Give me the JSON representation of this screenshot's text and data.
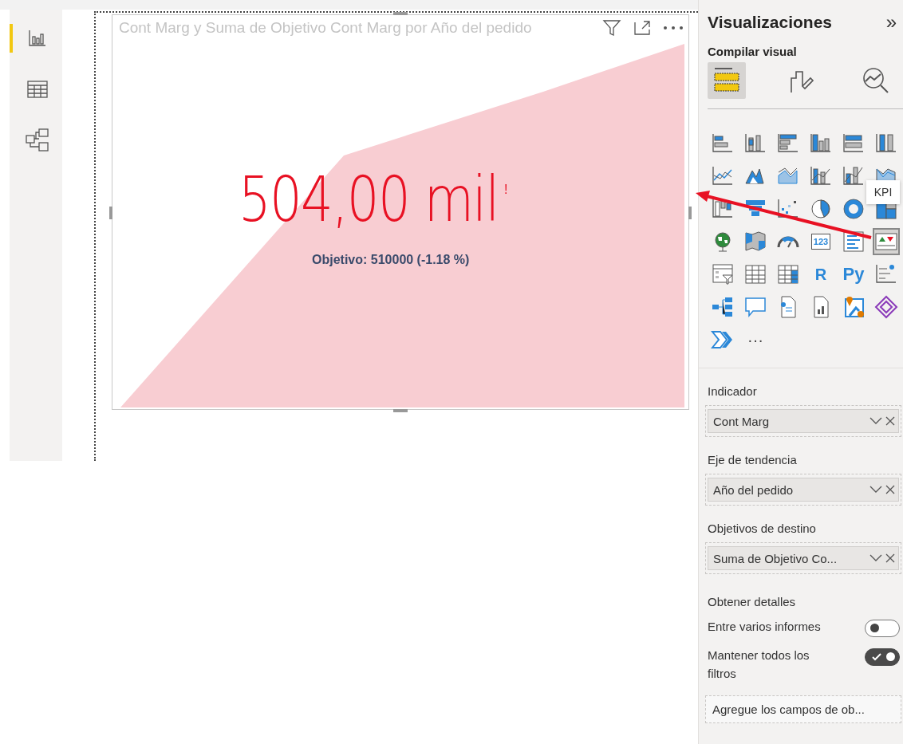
{
  "nav": [
    {
      "selected": true
    },
    {
      "selected": false
    },
    {
      "selected": false
    }
  ],
  "visual": {
    "title": "Cont Marg y Suma de Objetivo Cont Marg por Año del pedido",
    "value": "504,00 mil",
    "warning": "!",
    "goal": "Objetivo: 510000 (-1.18 %)"
  },
  "pane": {
    "title": "Visualizaciones",
    "collapse": "»",
    "subtitle": "Compilar visual",
    "tabs": [
      {
        "selected": true
      },
      {
        "selected": false
      },
      {
        "selected": false
      }
    ],
    "visuals": [
      {
        "selected": false
      },
      {
        "selected": false
      },
      {
        "selected": false
      },
      {
        "selected": false
      },
      {
        "selected": false
      },
      {
        "selected": false
      },
      {
        "selected": false
      },
      {
        "selected": false
      },
      {
        "selected": false
      },
      {
        "selected": false
      },
      {
        "selected": false
      },
      {
        "selected": false
      },
      {
        "selected": false
      },
      {
        "selected": false
      },
      {
        "selected": false
      },
      {
        "selected": false
      },
      {
        "selected": false
      },
      {
        "selected": false
      },
      {
        "selected": false
      },
      {
        "selected": false
      },
      {
        "selected": false
      },
      {
        "glyph": "123",
        "selected": false
      },
      {
        "selected": false
      },
      {
        "selected": true
      },
      {
        "selected": false
      },
      {
        "selected": false
      },
      {
        "selected": false
      },
      {
        "glyph": "R",
        "selected": false
      },
      {
        "glyph": "Py",
        "selected": false
      },
      {
        "selected": false
      },
      {
        "selected": false
      },
      {
        "selected": false
      },
      {
        "selected": false
      },
      {
        "selected": false
      },
      {
        "selected": false
      },
      {
        "selected": false
      },
      {
        "selected": false
      }
    ],
    "more": "···",
    "tooltip": "KPI",
    "wells": [
      {
        "label": "Indicador",
        "field": "Cont Marg"
      },
      {
        "label": "Eje de tendencia",
        "field": "Año del pedido"
      },
      {
        "label": "Objetivos de destino",
        "field": "Suma de Objetivo Co..."
      }
    ],
    "drill": {
      "title": "Obtener detalles",
      "toggles": [
        {
          "label": "Entre varios informes",
          "on": false
        },
        {
          "label": "Mantener todos los filtros",
          "on": true
        }
      ],
      "placeholder": "Agregue los campos de ob..."
    }
  }
}
